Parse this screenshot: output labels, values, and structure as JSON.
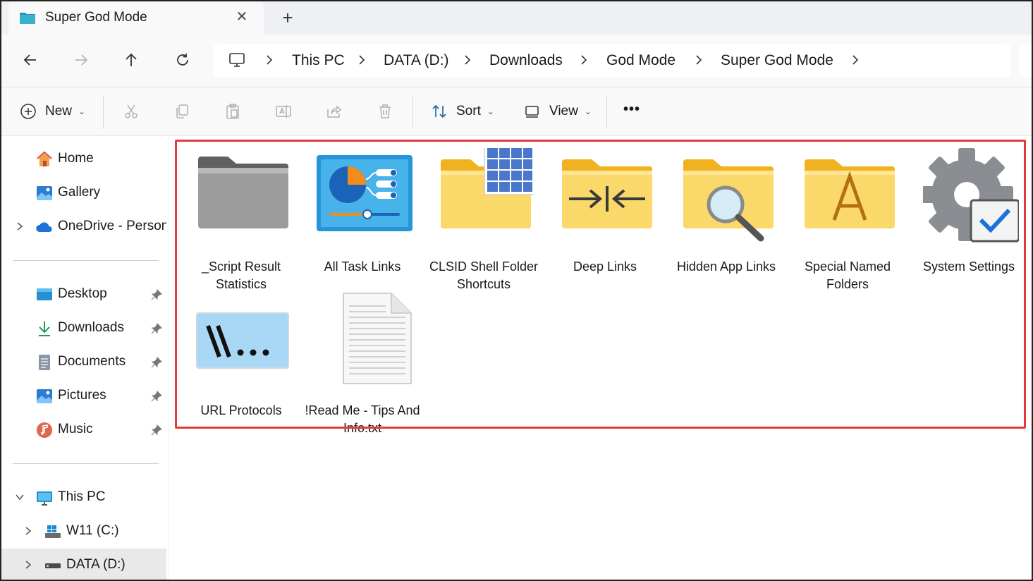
{
  "window": {
    "tab_title": "Super God Mode",
    "tab_close": "✕",
    "new_tab": "+"
  },
  "nav": {
    "buttons": [
      "back-arrow-icon",
      "forward-arrow-icon",
      "up-arrow-icon",
      "refresh-icon"
    ],
    "breadcrumb": [
      "This PC",
      "DATA (D:)",
      "Downloads",
      "God Mode",
      "Super God Mode"
    ]
  },
  "commands": {
    "new_label": "New",
    "sort_label": "Sort",
    "view_label": "View",
    "more_label": "•••",
    "caret": "⌄"
  },
  "sidebar": {
    "home": "Home",
    "gallery": "Gallery",
    "onedrive": "OneDrive - Persona",
    "desktop": "Desktop",
    "downloads": "Downloads",
    "documents": "Documents",
    "pictures": "Pictures",
    "music": "Music",
    "thispc": "This PC",
    "c_drive": "W11 (C:)",
    "d_drive": "DATA (D:)"
  },
  "items": [
    {
      "label": "_Script Result Statistics",
      "icon": "gray-folder-icon"
    },
    {
      "label": "All Task Links",
      "icon": "control-panel-icon"
    },
    {
      "label": "CLSID Shell Folder Shortcuts",
      "icon": "folder-grid-icon"
    },
    {
      "label": "Deep Links",
      "icon": "folder-arrows-icon"
    },
    {
      "label": "Hidden App Links",
      "icon": "folder-magnifier-icon"
    },
    {
      "label": "Special Named Folders",
      "icon": "folder-letter-a-icon"
    },
    {
      "label": "System Settings",
      "icon": "gear-check-icon"
    },
    {
      "label": "URL Protocols",
      "icon": "url-protocols-icon"
    },
    {
      "label": "!Read Me - Tips And Info.txt",
      "icon": "text-file-icon"
    }
  ],
  "colors": {
    "highlight_border": "#e23b3b",
    "folder_yellow": "#f9c846",
    "folder_gray": "#9a9a9a",
    "accent_blue": "#0067c0"
  }
}
